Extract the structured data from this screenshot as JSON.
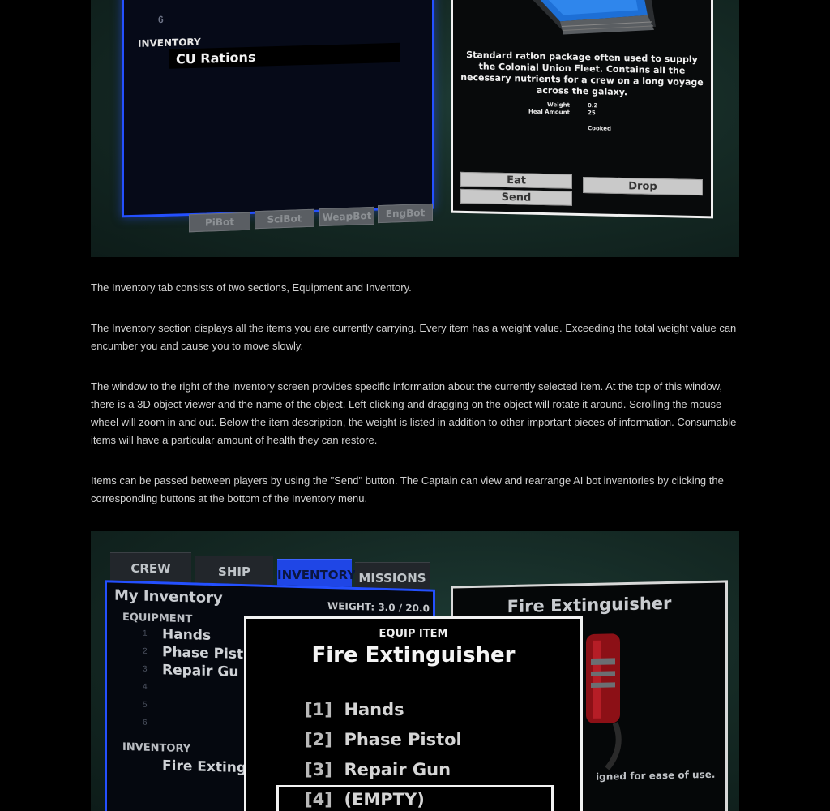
{
  "screenshot_top": {
    "slot_number": "6",
    "inventory_label": "INVENTORY",
    "selected_item": "CU Rations",
    "description": "Standard ration package often used to supply the Colonial Union Fleet. Contains all the necessary nutrients for a crew on a long voyage across the galaxy.",
    "stats": [
      {
        "label": "Weight",
        "value": "0.2"
      },
      {
        "label": "Heal Amount",
        "value": "25"
      }
    ],
    "status": "Cooked",
    "buttons": {
      "eat": "Eat",
      "send": "Send",
      "drop": "Drop"
    },
    "bot_buttons": [
      "PiBot",
      "SciBot",
      "WeapBot",
      "EngBot"
    ]
  },
  "paragraphs": [
    "The Inventory tab consists of two sections, Equipment and Inventory.",
    "The Inventory section displays all the items you are currently carrying. Every item has a weight value. Exceeding the total weight value can encumber you and cause you to move slowly.",
    "The window to the right of the inventory screen provides specific information about the currently selected item. At the top of this window, there is a 3D object viewer and the name of the object. Left-clicking and dragging on the object will rotate it around. Scrolling the mouse wheel will zoom in and out. Below the item description, the weight is listed in addition to other important pieces of information. Consumable items will have a particular amount of health they can restore.",
    "Items can be passed between players by using the \"Send\" button. The Captain can view and rearrange AI bot inventories by clicking the corresponding buttons at the bottom of the Inventory menu."
  ],
  "screenshot_bottom": {
    "tabs": [
      "CREW",
      "SHIP",
      "INVENTORY",
      "MISSIONS"
    ],
    "panel_title": "My Inventory",
    "weight_label": "WEIGHT:",
    "weight_value": "3.0 / 20.0",
    "equipment_label": "EQUIPMENT",
    "equipment_slots": [
      {
        "num": "1",
        "name": "Hands"
      },
      {
        "num": "2",
        "name": "Phase Pist"
      },
      {
        "num": "3",
        "name": "Repair Gu"
      },
      {
        "num": "4",
        "name": ""
      },
      {
        "num": "5",
        "name": ""
      },
      {
        "num": "6",
        "name": ""
      }
    ],
    "inventory_label": "INVENTORY",
    "inventory_item": "Fire Exting",
    "right_title": "Fire Extinguisher",
    "right_desc": "igned for ease of use.",
    "modal": {
      "header": "EQUIP ITEM",
      "title": "Fire Extinguisher",
      "options": [
        {
          "key": "[1]",
          "label": "Hands"
        },
        {
          "key": "[2]",
          "label": "Phase Pistol"
        },
        {
          "key": "[3]",
          "label": "Repair Gun"
        },
        {
          "key": "[4]",
          "label": "(EMPTY)"
        }
      ]
    },
    "colors": {
      "accent_blue": "#2450ff",
      "panel_white": "#f1f1f1",
      "background_teal": "#142823"
    }
  }
}
